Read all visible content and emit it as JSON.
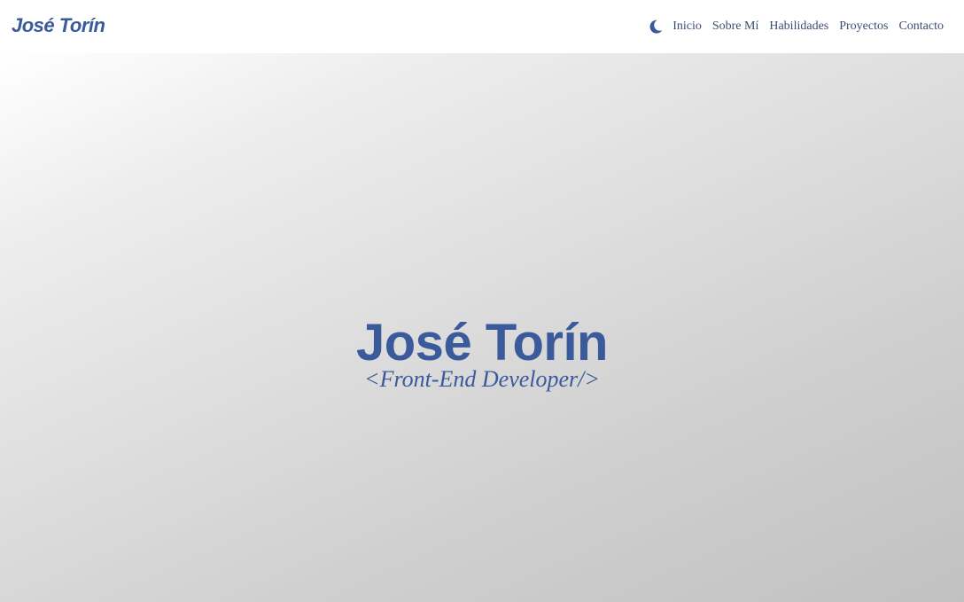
{
  "navbar": {
    "brand": "José Torín",
    "theme_icon": "moon-icon",
    "links": [
      {
        "label": "Inicio"
      },
      {
        "label": "Sobre Mí"
      },
      {
        "label": "Habilidades"
      },
      {
        "label": "Proyectos"
      },
      {
        "label": "Contacto"
      }
    ]
  },
  "hero": {
    "title": "José Torín",
    "subtitle": "<Front-End Developer/>"
  },
  "colors": {
    "accent": "#3a5a9c",
    "nav_text": "#3b4d73",
    "navbar_bg": "#ffffff",
    "hero_gradient_start": "#ffffff",
    "hero_gradient_end": "#c1c1c1"
  }
}
